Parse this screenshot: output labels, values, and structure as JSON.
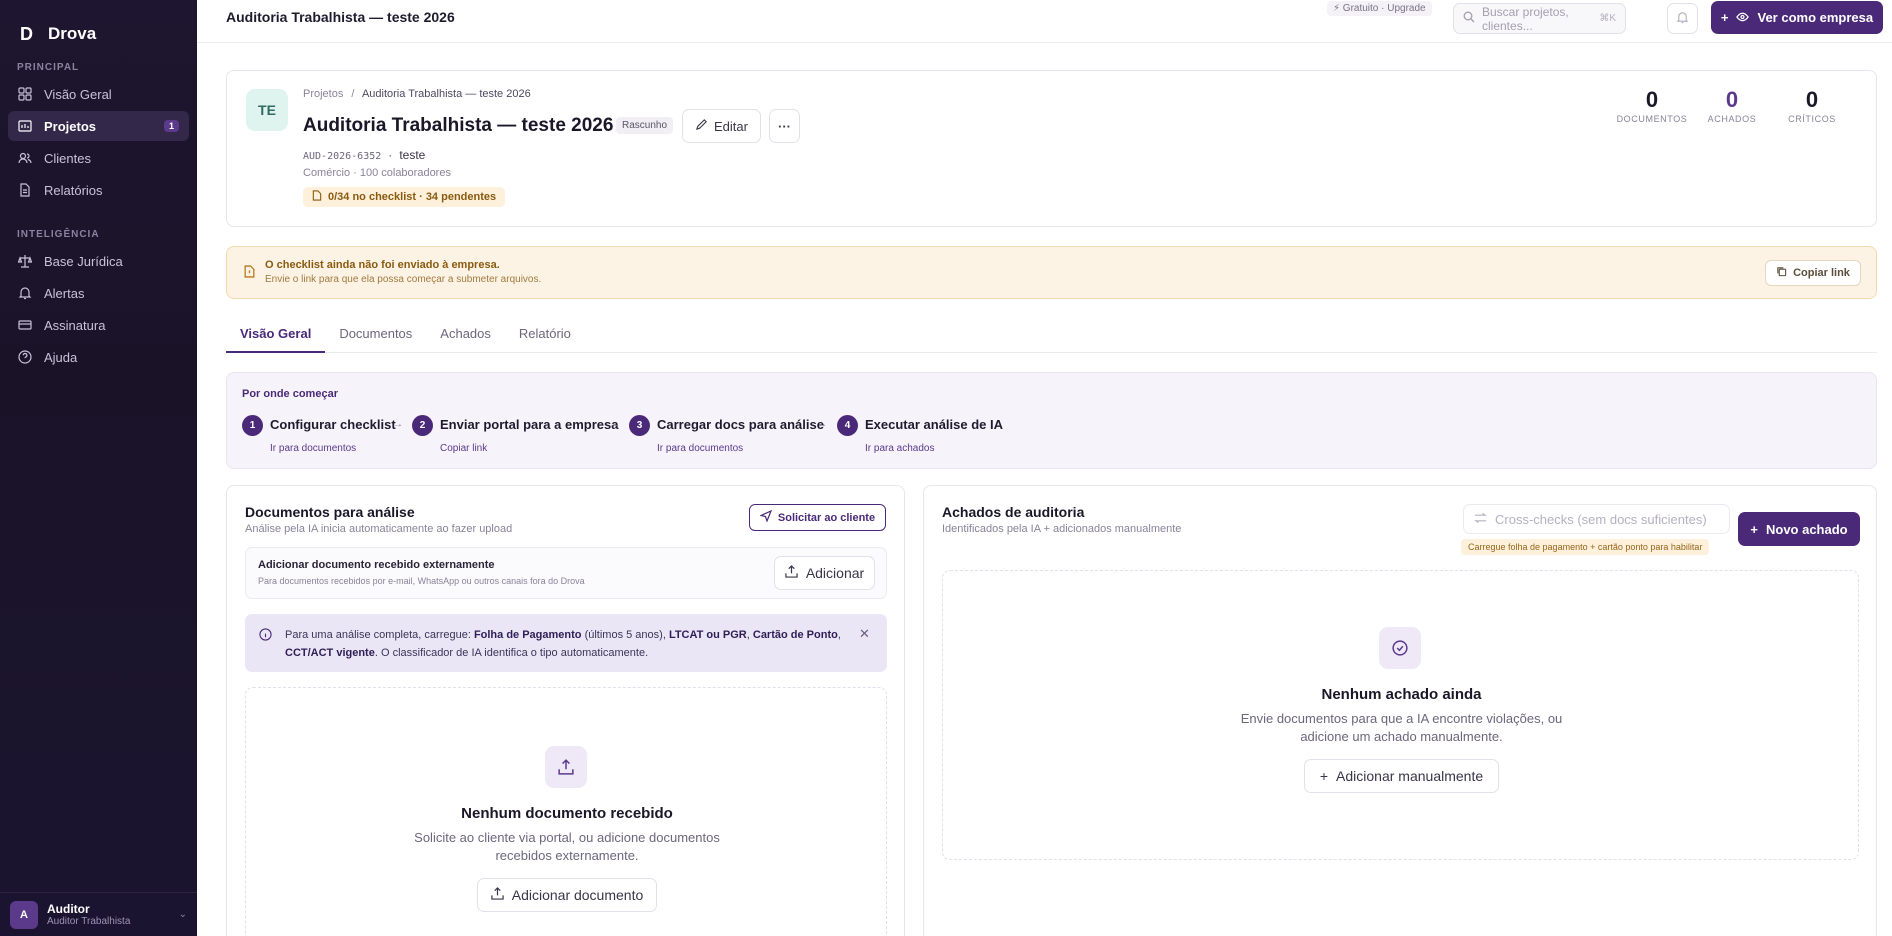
{
  "app": {
    "brand": "Drova"
  },
  "sidebar": {
    "section_principal": "PRINCIPAL",
    "section_inteligencia": "INTELIGÊNCIA",
    "items": [
      {
        "label": "Visão Geral",
        "icon": "grid-icon"
      },
      {
        "label": "Projetos",
        "icon": "folder-icon",
        "badge": "1"
      },
      {
        "label": "Clientes",
        "icon": "users-icon"
      },
      {
        "label": "Relatórios",
        "icon": "document-icon"
      },
      {
        "label": "Base Jurídica",
        "icon": "scale-icon"
      },
      {
        "label": "Alertas",
        "icon": "bell-icon"
      },
      {
        "label": "Assinatura",
        "icon": "card-icon"
      },
      {
        "label": "Ajuda",
        "icon": "help-icon"
      }
    ],
    "user": {
      "initial": "A",
      "name": "Auditor",
      "role": "Auditor Trabalhista"
    }
  },
  "topbar": {
    "title": "Auditoria Trabalhista — teste 2026",
    "plan": "⚡ Gratuito · Upgrade",
    "search_placeholder": "Buscar projetos, clientes...",
    "search_kbd": "⌘K",
    "primary_button": "Ver como empresa"
  },
  "project": {
    "avatar": "TE",
    "breadcrumb_root": "Projetos",
    "breadcrumb_sep": "/",
    "breadcrumb_current": "Auditoria Trabalhista — teste 2026",
    "title": "Auditoria Trabalhista — teste 2026",
    "status": "Rascunho",
    "edit_label": "Editar",
    "more_label": "···",
    "code": "AUD-2026-6352",
    "client": "teste",
    "meta": "Comércio · 100 colaboradores",
    "checklist": "0/34 no checklist · 34 pendentes",
    "stats": [
      {
        "value": "0",
        "label": "DOCUMENTOS"
      },
      {
        "value": "0",
        "label": "ACHADOS"
      },
      {
        "value": "0",
        "label": "CRÍTICOS"
      }
    ]
  },
  "banner": {
    "title": "O checklist ainda não foi enviado à empresa.",
    "subtitle": "Envie o link para que ela possa começar a submeter arquivos.",
    "button": "Copiar link"
  },
  "tabs": [
    "Visão Geral",
    "Documentos",
    "Achados",
    "Relatório"
  ],
  "getting_started": {
    "title": "Por onde começar",
    "steps": [
      {
        "num": "1",
        "label": "Configurar checklist",
        "link": "Ir para documentos"
      },
      {
        "num": "2",
        "label": "Enviar portal para a empresa",
        "link": "Copiar link"
      },
      {
        "num": "3",
        "label": "Carregar docs para análise",
        "link": "Ir para documentos"
      },
      {
        "num": "4",
        "label": "Executar análise de IA",
        "link": "Ir para achados"
      }
    ],
    "arrow": "→"
  },
  "documents": {
    "title": "Documentos para análise",
    "subtitle": "Análise pela IA inicia automaticamente ao fazer upload",
    "request_button": "Solicitar ao cliente",
    "external_title": "Adicionar documento recebido externamente",
    "external_sub": "Para documentos recebidos por e-mail, WhatsApp ou outros canais fora do Drova",
    "add_button": "Adicionar",
    "info": {
      "t1": "Para uma análise completa, carregue: ",
      "b1": "Folha de Pagamento",
      "t2": " (últimos 5 anos), ",
      "b2": "LTCAT ou PGR",
      "t3": ", ",
      "b3": "Cartão de Ponto",
      "t4": ", ",
      "b4": "CCT/ACT vigente",
      "t5": ". O classificador de IA identifica o tipo automaticamente."
    },
    "empty_title": "Nenhum documento recebido",
    "empty_sub": "Solicite ao cliente via portal, ou adicione documentos recebidos externamente.",
    "empty_button": "Adicionar documento"
  },
  "findings": {
    "title": "Achados de auditoria",
    "subtitle": "Identificados pela IA + adicionados manualmente",
    "cross_checks": "Cross-checks (sem docs suficientes)",
    "cross_hint": "Carregue folha de pagamento + cartão ponto para habilitar",
    "new_button": "Novo achado",
    "empty_title": "Nenhum achado ainda",
    "empty_sub": "Envie documentos para que a IA encontre violações, ou adicione um achado manualmente.",
    "empty_button": "Adicionar manualmente"
  }
}
